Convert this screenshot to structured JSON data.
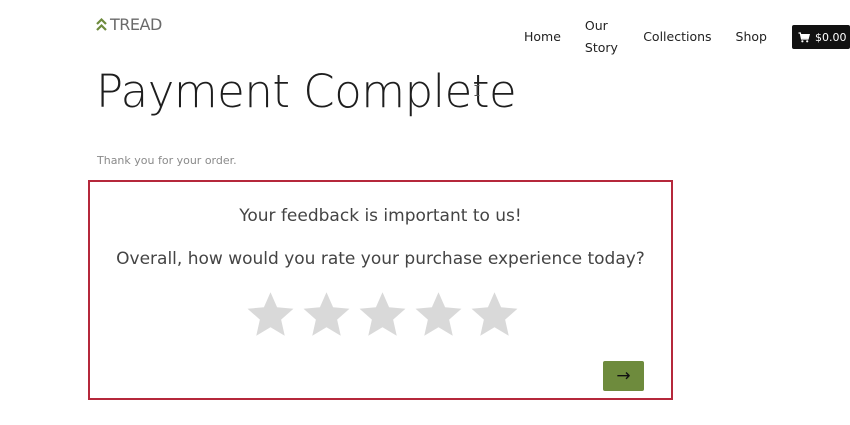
{
  "header": {
    "logo_text": "TREAD",
    "nav": [
      {
        "label": "Home"
      },
      {
        "label": "Our Story"
      },
      {
        "label": "Collections"
      },
      {
        "label": "Shop"
      }
    ],
    "cart_total": "$0.00"
  },
  "main": {
    "title": "Payment Complete",
    "thanks": "Thank you for your order."
  },
  "feedback": {
    "heading": "Your feedback is important to us!",
    "question": "Overall, how would you rate your purchase experience today?",
    "rating": {
      "value": 0,
      "max": 5
    },
    "next_label": "→"
  },
  "colors": {
    "brand_green": "#6e8b3d",
    "feedback_border": "#b5283b",
    "star_empty": "#d9d9d9",
    "cart_bg": "#111111"
  }
}
